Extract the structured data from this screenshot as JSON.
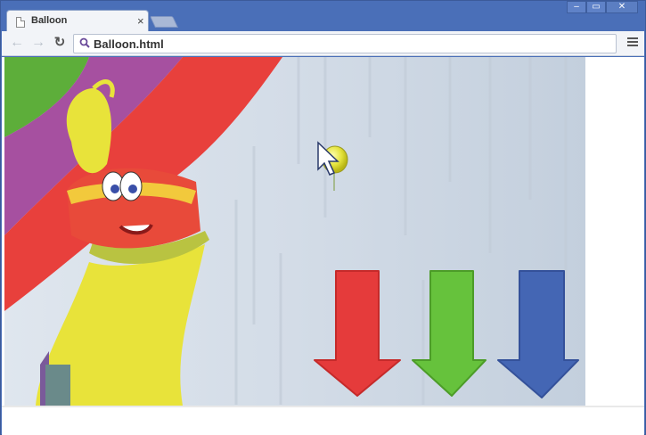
{
  "browser": {
    "tab": {
      "title": "Balloon"
    },
    "omnibox": {
      "url": "Balloon.html"
    }
  },
  "colors": {
    "frame": "#4a6fb8",
    "arrow_red": "#e53b3b",
    "arrow_green": "#66c23c",
    "arrow_blue": "#4466b4",
    "balloon": "#e4e33c",
    "wall": "#d3dde8"
  },
  "game": {
    "arrows": [
      "red-arrow",
      "green-arrow",
      "blue-arrow"
    ],
    "cursor": "pointer-cursor-icon"
  }
}
